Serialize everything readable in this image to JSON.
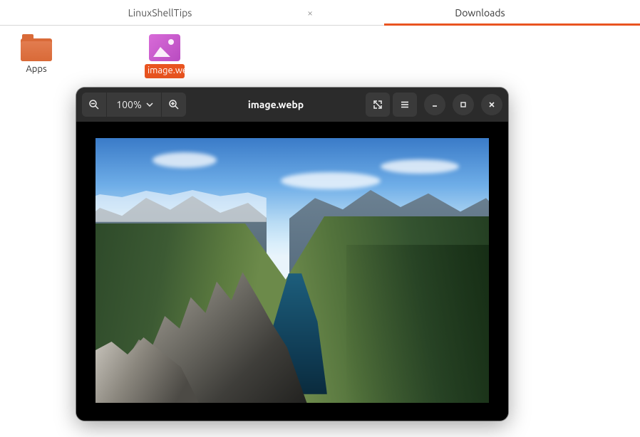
{
  "tabs": [
    {
      "label": "LinuxShellTips",
      "active": false
    },
    {
      "label": "Downloads",
      "active": true
    }
  ],
  "files": {
    "folder": {
      "name": "Apps"
    },
    "image": {
      "name": "image.webp"
    }
  },
  "viewer": {
    "title": "image.webp",
    "zoom_label": "100%"
  }
}
